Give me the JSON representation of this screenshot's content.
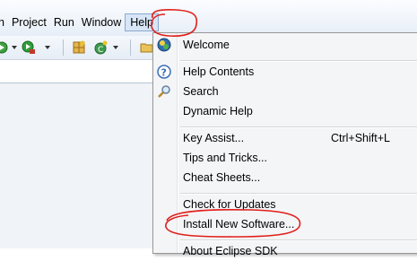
{
  "menubar": {
    "items": [
      {
        "label": "h"
      },
      {
        "label": "Project"
      },
      {
        "label": "Run"
      },
      {
        "label": "Window"
      },
      {
        "label": "Help"
      }
    ]
  },
  "toolbar": {
    "icons": [
      "debug-icon",
      "run-icon",
      "new-package-icon",
      "new-class-icon",
      "open-folder-icon"
    ]
  },
  "help_menu": {
    "items": [
      {
        "label": "Welcome",
        "icon": "welcome-icon"
      },
      {
        "label": "Help Contents",
        "icon": "help-contents-icon"
      },
      {
        "label": "Search",
        "icon": "search-icon"
      },
      {
        "label": "Dynamic Help"
      },
      {
        "label": "Key Assist...",
        "accelerator": "Ctrl+Shift+L"
      },
      {
        "label": "Tips and Tricks..."
      },
      {
        "label": "Cheat Sheets..."
      },
      {
        "label": "Check for Updates"
      },
      {
        "label": "Install New Software..."
      },
      {
        "label": "About Eclipse SDK"
      }
    ]
  },
  "annotation_color": "#e0201c"
}
